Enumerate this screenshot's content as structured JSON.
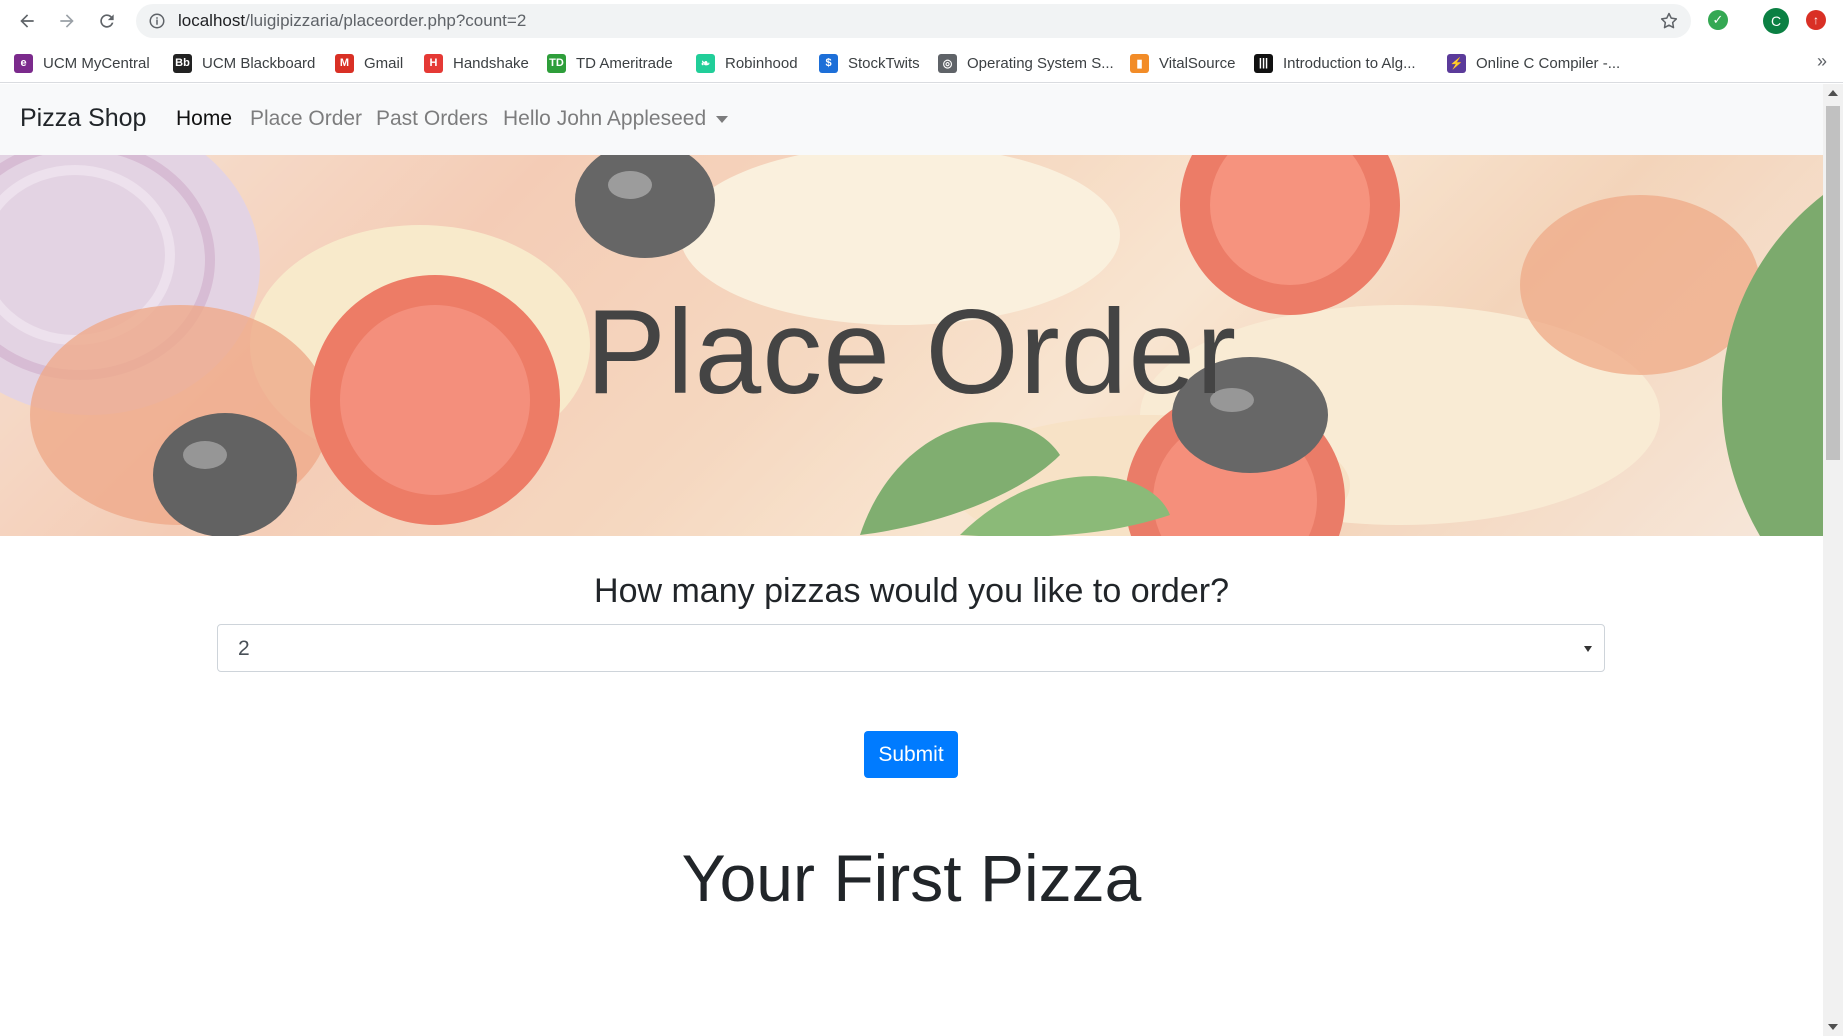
{
  "browser": {
    "url_host": "localhost",
    "url_path": "/luigipizzaria/placeorder.php?count=2",
    "profile_initial": "C",
    "bookmarks": [
      {
        "label": "UCM MyCentral",
        "icon": "ucm-mycentral-icon",
        "color": "#7b2a8c"
      },
      {
        "label": "UCM Blackboard",
        "icon": "blackboard-icon",
        "color": "#222222"
      },
      {
        "label": "Gmail",
        "icon": "gmail-icon",
        "color": "#d93025"
      },
      {
        "label": "Handshake",
        "icon": "handshake-icon",
        "color": "#e53935"
      },
      {
        "label": "TD Ameritrade",
        "icon": "td-ameritrade-icon",
        "color": "#2e9e3a"
      },
      {
        "label": "Robinhood",
        "icon": "robinhood-icon",
        "color": "#21ce99"
      },
      {
        "label": "StockTwits",
        "icon": "stocktwits-icon",
        "color": "#1d6fd8"
      },
      {
        "label": "Operating System S...",
        "icon": "globe-icon",
        "color": "#5f6368"
      },
      {
        "label": "VitalSource",
        "icon": "vitalsource-icon",
        "color": "#f28c28"
      },
      {
        "label": "Introduction to Alg...",
        "icon": "book-barcode-icon",
        "color": "#111111"
      },
      {
        "label": "Online C Compiler -...",
        "icon": "compiler-icon",
        "color": "#5b3b9a"
      }
    ],
    "more_label": "»"
  },
  "navbar": {
    "brand": "Pizza Shop",
    "links": [
      {
        "label": "Home",
        "active": true
      },
      {
        "label": "Place Order",
        "active": false
      },
      {
        "label": "Past Orders",
        "active": false
      }
    ],
    "user_menu": "Hello John Appleseed"
  },
  "hero": {
    "title": "Place Order"
  },
  "form": {
    "question": "How many pizzas would you like to order?",
    "selected_count": "2",
    "submit_label": "Submit"
  },
  "section": {
    "title": "Your First Pizza"
  },
  "colors": {
    "primary": "#007bff",
    "navbar_bg": "#f8f9fa"
  }
}
